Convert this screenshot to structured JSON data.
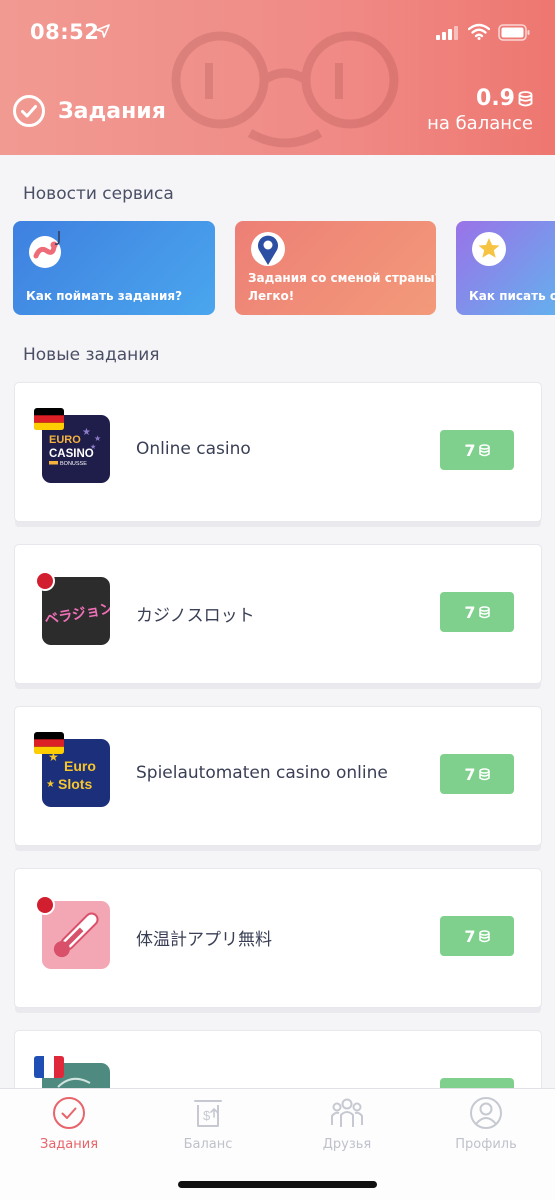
{
  "status_bar": {
    "time": "08:52"
  },
  "header": {
    "title": "Задания",
    "balance_amount": "0.9",
    "balance_label": "на балансе"
  },
  "sections": {
    "news_title": "Новости сервиса",
    "tasks_title": "Новые задания"
  },
  "news": [
    {
      "text": "Как поймать задания?"
    },
    {
      "text_line1": "Задания со сменой страны?",
      "text_line2": "Легко!"
    },
    {
      "text": "Как писать о"
    }
  ],
  "tasks": [
    {
      "name": "Online casino",
      "price": "7",
      "flag": "germany",
      "icon_lines": [
        "EURO",
        "CASINO",
        "BONUSSE"
      ]
    },
    {
      "name": "カジノスロット",
      "price": "7",
      "flag": "japan",
      "icon_lines": [
        "ベラジョン"
      ]
    },
    {
      "name": "Spielautomaten casino online",
      "price": "7",
      "flag": "germany",
      "icon_lines": [
        "Euro",
        "Slots"
      ]
    },
    {
      "name": "体温計アプリ無料",
      "price": "7",
      "flag": "japan",
      "icon_lines": []
    },
    {
      "name": "",
      "price": "",
      "flag": "france",
      "icon_lines": []
    }
  ],
  "tabbar": {
    "tasks": "Задания",
    "balance": "Баланс",
    "friends": "Друзья",
    "profile": "Профиль"
  },
  "colors": {
    "accent": "#e8646a",
    "price_green": "#7ed08c",
    "header_gradient": [
      "#f19a92",
      "#ee7770"
    ]
  }
}
